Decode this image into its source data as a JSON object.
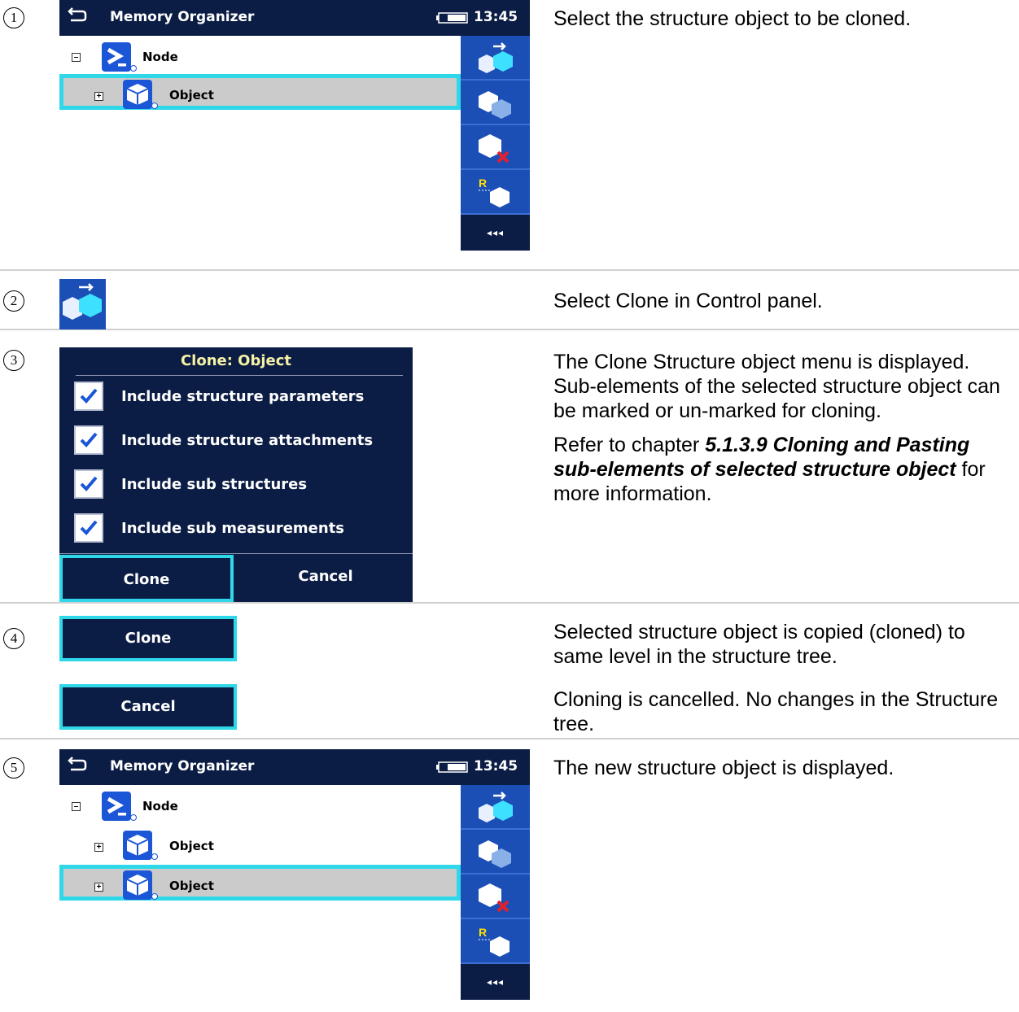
{
  "steps": [
    {
      "num": "1",
      "text": "Select the structure object to be cloned."
    },
    {
      "num": "2",
      "text": "Select Clone in Control panel."
    },
    {
      "num": "3",
      "text_a": "The Clone Structure object menu is displayed. Sub-elements of the selected structure object can be marked or un-marked for cloning.",
      "text_b_pre": "Refer to chapter ",
      "text_b_bold": "5.1.3.9 Cloning and Pasting sub-elements of selected structure object",
      "text_b_post": " for more information."
    },
    {
      "num": "4",
      "text_a": "Selected structure object is copied (cloned) to same level in the structure tree.",
      "text_b": "Cloning is cancelled. No changes in the Structure tree."
    },
    {
      "num": "5",
      "text": "The new structure object is displayed."
    }
  ],
  "screen": {
    "title": "Memory Organizer",
    "clock": "13:45",
    "more_label": "◂◂◂",
    "node_label": "Node",
    "object_label": "Object",
    "control_buttons": [
      "clone-icon",
      "copy-icon",
      "delete-icon",
      "rename-icon"
    ]
  },
  "dialog": {
    "title": "Clone: Object",
    "options": [
      {
        "label": "Include structure parameters",
        "checked": true
      },
      {
        "label": "Include structure attachments",
        "checked": true
      },
      {
        "label": "Include sub structures",
        "checked": true
      },
      {
        "label": "Include sub measurements",
        "checked": true
      }
    ],
    "clone_label": "Clone",
    "cancel_label": "Cancel"
  },
  "colors": {
    "navy": "#0c1d45",
    "panel_blue": "#1b4fb6",
    "highlight_cyan": "#2fd8e9",
    "selected_row": "#cbcbcb",
    "dialog_title": "#f6f2a6"
  }
}
